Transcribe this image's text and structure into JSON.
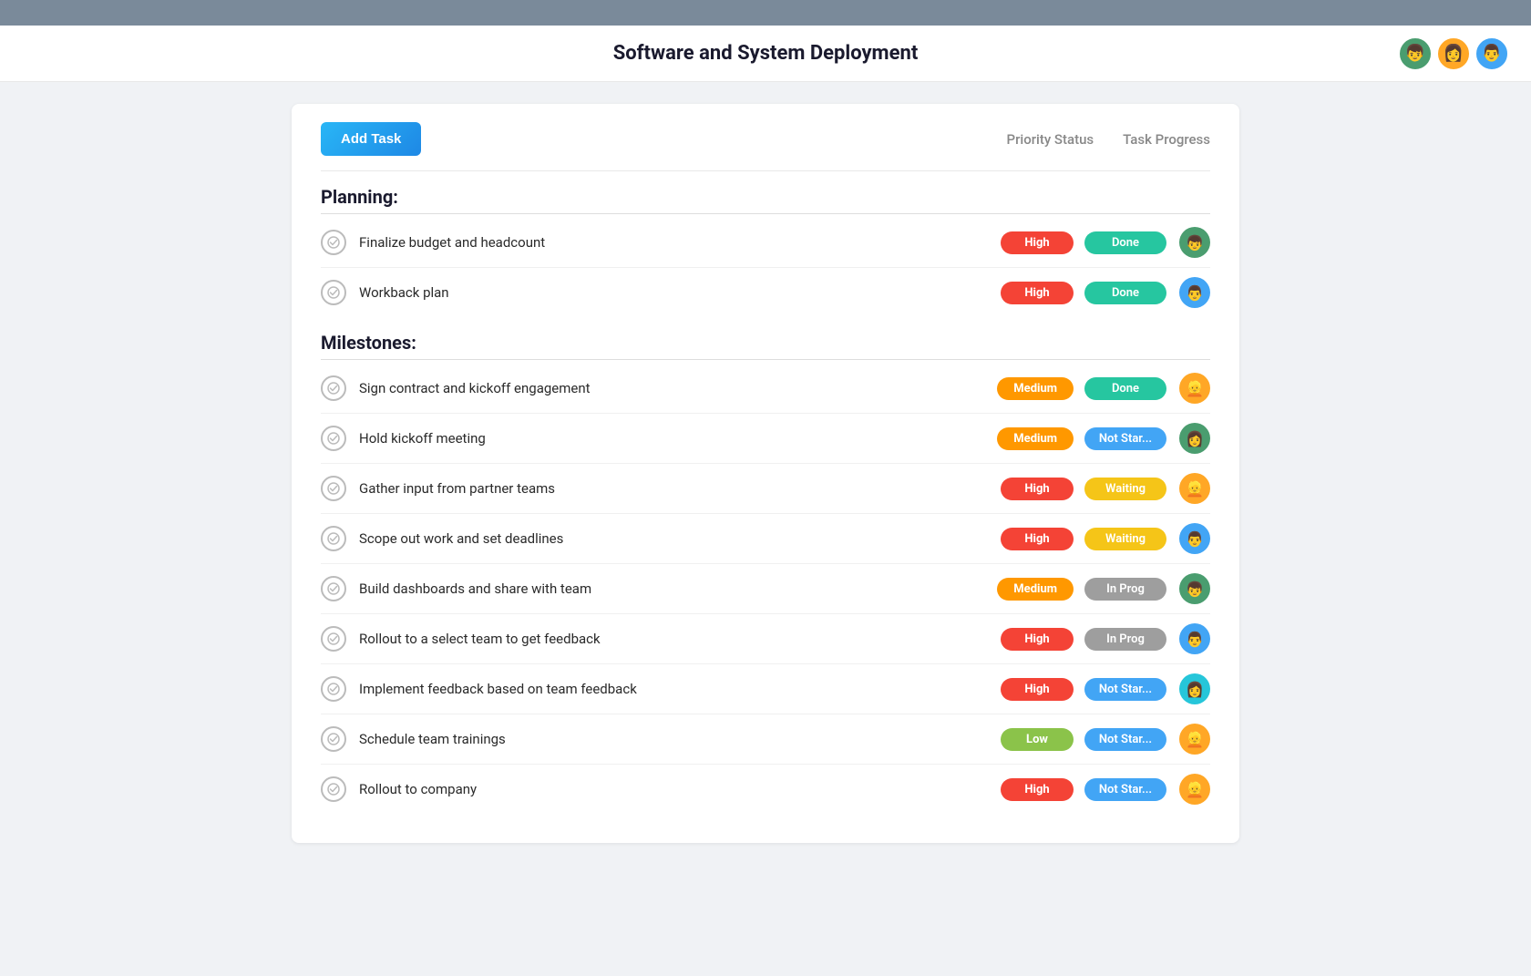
{
  "topBar": {},
  "header": {
    "title": "Software and System Deployment",
    "avatars": [
      {
        "id": "av1",
        "emoji": "👦",
        "color": "#4a9d6f"
      },
      {
        "id": "av2",
        "emoji": "👩",
        "color": "#e8a020"
      },
      {
        "id": "av3",
        "emoji": "👨",
        "color": "#5b8ec4"
      }
    ]
  },
  "toolbar": {
    "addTaskLabel": "Add Task",
    "col1": "Priority Status",
    "col2": "Task Progress"
  },
  "sections": [
    {
      "title": "Planning:",
      "tasks": [
        {
          "name": "Finalize budget and headcount",
          "priority": "High",
          "priorityClass": "priority-high",
          "status": "Done",
          "statusClass": "status-done",
          "avatarClass": "av-green",
          "emoji": "👦"
        },
        {
          "name": "Workback plan",
          "priority": "High",
          "priorityClass": "priority-high",
          "status": "Done",
          "statusClass": "status-done",
          "avatarClass": "av-blue",
          "emoji": "👨"
        }
      ]
    },
    {
      "title": "Milestones:",
      "tasks": [
        {
          "name": "Sign contract and kickoff engagement",
          "priority": "Medium",
          "priorityClass": "priority-medium",
          "status": "Done",
          "statusClass": "status-done",
          "avatarClass": "av-yellow",
          "emoji": "👱"
        },
        {
          "name": "Hold kickoff meeting",
          "priority": "Medium",
          "priorityClass": "priority-medium",
          "status": "Not Star...",
          "statusClass": "status-not-started",
          "avatarClass": "av-green",
          "emoji": "👩"
        },
        {
          "name": "Gather input from partner teams",
          "priority": "High",
          "priorityClass": "priority-high",
          "status": "Waiting",
          "statusClass": "status-waiting",
          "avatarClass": "av-yellow",
          "emoji": "👱"
        },
        {
          "name": "Scope out work and set deadlines",
          "priority": "High",
          "priorityClass": "priority-high",
          "status": "Waiting",
          "statusClass": "status-waiting",
          "avatarClass": "av-blue",
          "emoji": "👨"
        },
        {
          "name": "Build dashboards and share with team",
          "priority": "Medium",
          "priorityClass": "priority-medium",
          "status": "In Prog",
          "statusClass": "status-in-progress",
          "avatarClass": "av-green",
          "emoji": "👦"
        },
        {
          "name": "Rollout to a select team to get feedback",
          "priority": "High",
          "priorityClass": "priority-high",
          "status": "In Prog",
          "statusClass": "status-in-progress",
          "avatarClass": "av-blue",
          "emoji": "👨"
        },
        {
          "name": "Implement feedback based on team feedback",
          "priority": "High",
          "priorityClass": "priority-high",
          "status": "Not Star...",
          "statusClass": "status-not-started",
          "avatarClass": "av-cyan",
          "emoji": "👩"
        },
        {
          "name": "Schedule team trainings",
          "priority": "Low",
          "priorityClass": "priority-low",
          "status": "Not Star...",
          "statusClass": "status-not-started",
          "avatarClass": "av-yellow",
          "emoji": "👱"
        },
        {
          "name": "Rollout to company",
          "priority": "High",
          "priorityClass": "priority-high",
          "status": "Not Star...",
          "statusClass": "status-not-started",
          "avatarClass": "av-yellow",
          "emoji": "👱"
        }
      ]
    }
  ]
}
